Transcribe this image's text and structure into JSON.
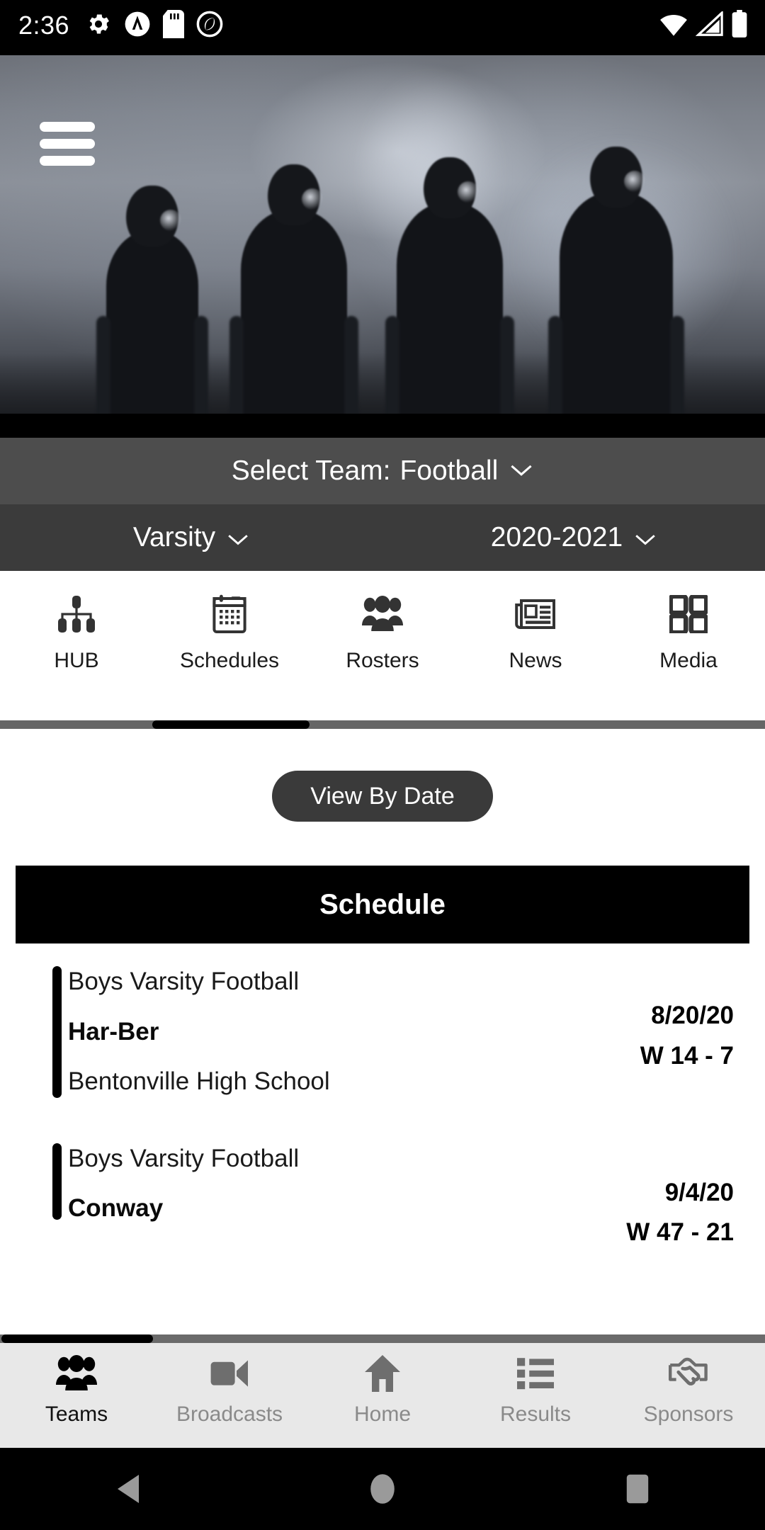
{
  "status_bar": {
    "time": "2:36",
    "left_icons": [
      "gear-icon",
      "circle-a-icon",
      "sd-card-icon",
      "circle-swirl-icon"
    ],
    "right_icons": [
      "wifi-icon",
      "cell-signal-icon",
      "battery-icon"
    ]
  },
  "hero": {
    "menu_icon": "hamburger-menu-icon",
    "description": "football-team-entrance-video"
  },
  "team_selector": {
    "label": "Select Team:",
    "value": "Football",
    "chevron": "chevron-down-icon"
  },
  "sub_selectors": {
    "level": "Varsity",
    "season": "2020-2021",
    "chevron": "chevron-down-icon"
  },
  "tabs": {
    "active_index": 1,
    "items": [
      {
        "label": "HUB",
        "icon": "org-chart-icon"
      },
      {
        "label": "Schedules",
        "icon": "calendar-icon"
      },
      {
        "label": "Rosters",
        "icon": "people-group-icon"
      },
      {
        "label": "News",
        "icon": "newspaper-icon"
      },
      {
        "label": "Media",
        "icon": "grid-squares-icon"
      }
    ]
  },
  "content": {
    "view_by_date_label": "View By Date",
    "schedule_heading": "Schedule",
    "games": [
      {
        "sport": "Boys Varsity Football",
        "opponent": "Har-Ber",
        "location": "Bentonville High School",
        "date": "8/20/20",
        "result": "W 14 - 7"
      },
      {
        "sport": "Boys Varsity Football",
        "opponent": "Conway",
        "location": "",
        "date": "9/4/20",
        "result": "W 47 - 21"
      }
    ]
  },
  "bottom_nav": {
    "active_index": 0,
    "items": [
      {
        "label": "Teams",
        "icon": "people-group-icon"
      },
      {
        "label": "Broadcasts",
        "icon": "video-camera-icon"
      },
      {
        "label": "Home",
        "icon": "house-icon"
      },
      {
        "label": "Results",
        "icon": "list-icon"
      },
      {
        "label": "Sponsors",
        "icon": "handshake-icon"
      }
    ]
  },
  "android_nav": {
    "back": "back-triangle-icon",
    "home": "home-circle-icon",
    "recents": "recents-square-icon"
  },
  "colors": {
    "accent_black": "#000000",
    "select_bar": "#4d4d4d",
    "sub_bar": "#3b3b3b",
    "pill": "#3a3a3a",
    "bottom_nav_bg": "#e8e8e8",
    "inactive_text": "#8a8a8a"
  }
}
